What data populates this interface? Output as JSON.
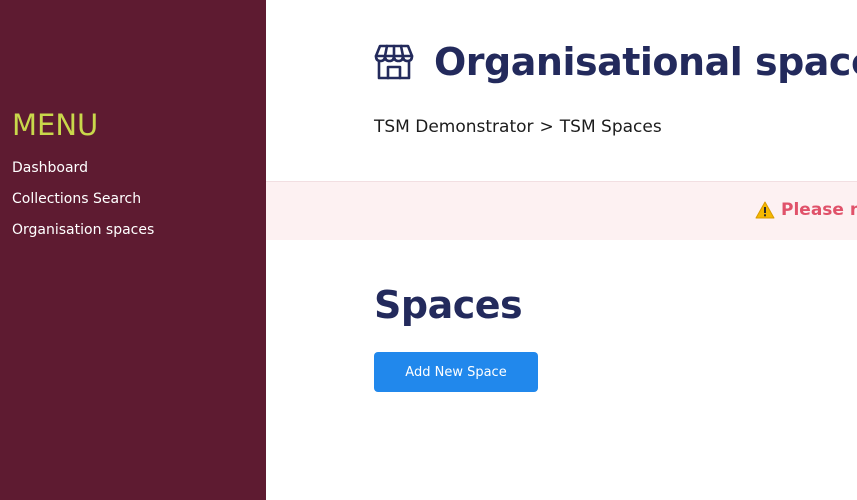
{
  "sidebar": {
    "menu_title": "MENU",
    "items": [
      {
        "label": "Dashboard"
      },
      {
        "label": "Collections Search"
      },
      {
        "label": "Organisation spaces"
      }
    ]
  },
  "header": {
    "icon": "storefront-icon",
    "title": "Organisational spaces"
  },
  "breadcrumb": {
    "items": [
      {
        "label": "TSM Demonstrator"
      },
      {
        "label": "TSM Spaces"
      }
    ],
    "separator": ">"
  },
  "alert": {
    "icon": "warning-icon",
    "text": "Please n"
  },
  "spaces": {
    "title": "Spaces",
    "add_button_label": "Add New Space"
  },
  "colors": {
    "sidebar_bg": "#5e1b31",
    "menu_title": "#c9d84b",
    "heading": "#232a5c",
    "alert_bg": "#fdf1f2",
    "alert_text": "#e0526a",
    "primary_button": "#2188ec"
  }
}
